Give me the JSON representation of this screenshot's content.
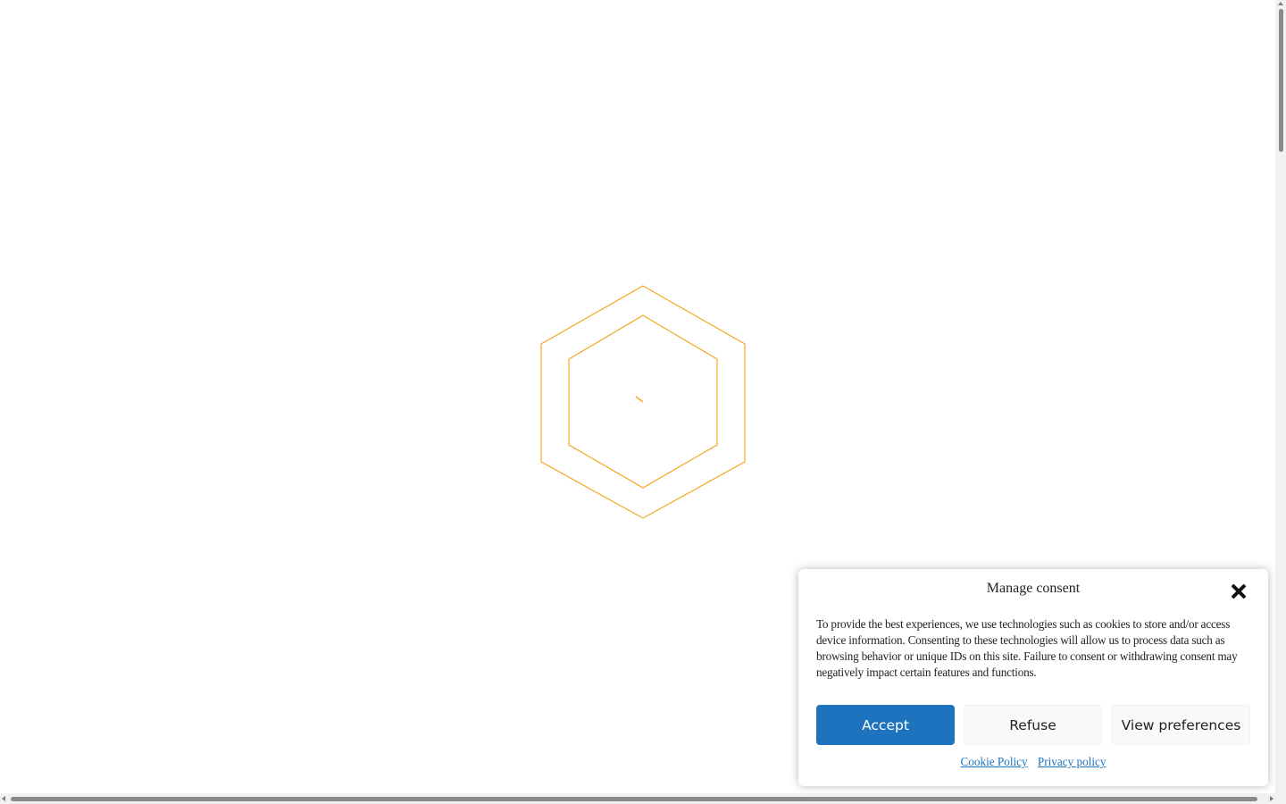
{
  "loader": {
    "icon": "hexagon-loader-icon",
    "color": "#f5a623"
  },
  "consent": {
    "title": "Manage consent",
    "message": "To provide the best experiences, we use technologies such as cookies to store and/or access device information. Consenting to these technologies will allow us to process data such as browsing behavior or unique IDs on this site. Failure to consent or withdrawing consent may negatively impact certain features and functions.",
    "buttons": {
      "accept": "Accept",
      "refuse": "Refuse",
      "preferences": "View preferences"
    },
    "links": {
      "cookie_policy": "Cookie Policy",
      "privacy_policy": "Privacy policy"
    },
    "accent_color": "#1e73be"
  }
}
